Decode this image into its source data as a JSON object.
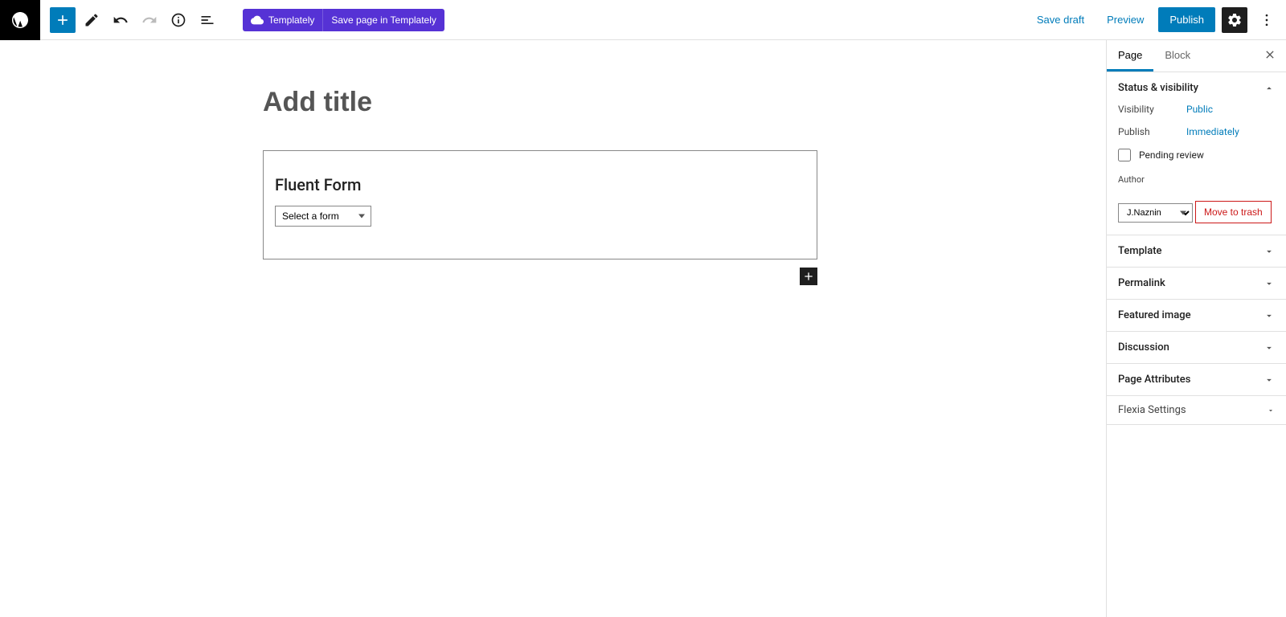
{
  "toolbar": {
    "templately_label": "Templately",
    "save_in_templately_label": "Save page in Templately",
    "save_draft_label": "Save draft",
    "preview_label": "Preview",
    "publish_label": "Publish"
  },
  "editor": {
    "title_placeholder": "Add title",
    "block_heading": "Fluent Form",
    "form_select_placeholder": "Select a form"
  },
  "sidebar": {
    "tabs": {
      "page": "Page",
      "block": "Block"
    },
    "status_visibility": {
      "heading": "Status & visibility",
      "visibility_label": "Visibility",
      "visibility_value": "Public",
      "publish_label": "Publish",
      "publish_value": "Immediately",
      "pending_review_label": "Pending review",
      "author_label": "Author",
      "author_value": "J.Naznin",
      "trash_label": "Move to trash"
    },
    "panels": {
      "template": "Template",
      "permalink": "Permalink",
      "featured_image": "Featured image",
      "discussion": "Discussion",
      "page_attributes": "Page Attributes",
      "flexia": "Flexia Settings"
    }
  }
}
